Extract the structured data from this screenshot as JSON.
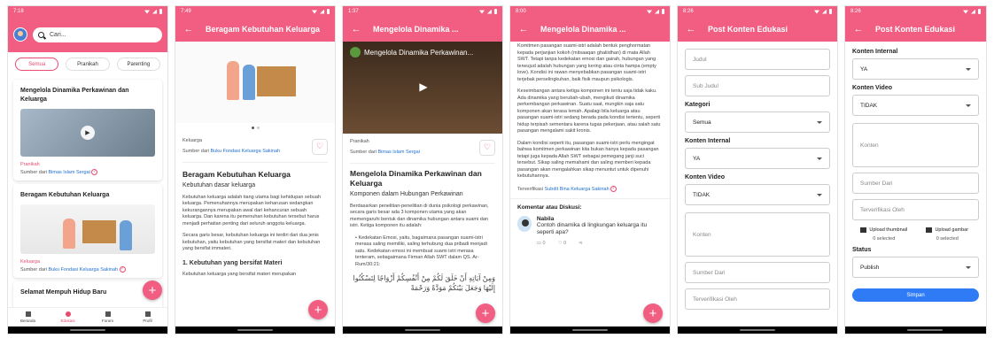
{
  "colors": {
    "primary": "#f25d82",
    "accent": "#e84a70",
    "link": "#1f6fcf",
    "save": "#2f7bf6"
  },
  "screens": [
    {
      "time": "7:18",
      "search_placeholder": "Cari...",
      "chips": [
        "Semua",
        "Pranikah",
        "Parenting"
      ],
      "cards": [
        {
          "title": "Mengelola Dinamika Perkawinan dan Keluarga",
          "category": "Pranikah",
          "source_prefix": "Sumber dari",
          "source": "Bimas Islam Sergai"
        },
        {
          "title": "Beragam Kebutuhan Keluarga",
          "category": "Keluarga",
          "source_prefix": "Sumber dari",
          "source": "Buku Fondasi Keluarga Sakinah"
        },
        {
          "title": "Selamat Mempuh Hidup Baru"
        }
      ],
      "nav": [
        "Beranda",
        "Edukasi",
        "Forum",
        "Profil"
      ],
      "fab": "+"
    },
    {
      "time": "7:49",
      "title": "Beragam Kebutuhan Keluarga",
      "category": "Keluarga",
      "source_prefix": "Sumber dari",
      "source": "Buku Fondasi Keluarga Sakinah",
      "heading": "Beragam Kebutuhan Keluarga",
      "subheading": "Kebutuhan dasar keluarga",
      "para1": "Kebutuhan keluarga adalah tiang utama bagi kehidupan sebuah keluarga. Pemenuhannya merupakan keharusan sedangkan kekurangannya merupakan awal dari kehancuran sebuah keluarga. Dan karena itu pemenuhan kebutuhan tersebut harus menjadi perhatian penting dari seluruh anggota keluarga.",
      "para2": "Secara garis besar, kebutuhan keluarga ini terdiri dari dua jenis kebutuhan, yaitu kebutuhan yang bersifat materi dan kebutuhan yang bersifat immateri.",
      "section": "1. Kebutuhan yang bersifat Materi",
      "para3": "Kebutuhan keluarga yang bersifat materi merupakan",
      "fab": "+"
    },
    {
      "time": "1:37",
      "title": "Mengelola Dinamika ...",
      "video_title": "Mengelola Dinamika Perkawinan...",
      "category": "Pranikah",
      "source_prefix": "Sumber dari",
      "source": "Bimas Islam Sergai",
      "heading": "Mengelola Dinamika Perkawinan dan Keluarga",
      "subheading": "Komponen dalam Hubungan Perkawinan",
      "para1": "Berdasarkan penelitian-penelitian di dunia psikologi perkawinan, secara garis besar ada 3 komponen utama yang akan memengaruhi bentuk dan dinamika hubungan antara suami dan istri. Ketiga komponen itu adalah:",
      "bullet": "Kedekatan Emosi, yaitu, bagaimana pasangan suami-istri merasa saling memiliki, saling terhubung dua pribadi menjadi satu. Kedekatan emosi ini membuat suami istri merasa tenteram, sebagaimana Firman Allah SWT dalam QS. Ar-Rum/30:21:",
      "arabic": "وَمِنْ آيَاتِهِ أَنْ خَلَقَ لَكُمْ مِنْ أَنْفُسِكُمْ أَزْوَاجًا لِتَسْكُنُوا إِلَيْهَا وَجَعَلَ بَيْنَكُمْ مَوَدَّةً وَرَحْمَةً",
      "fab": "+"
    },
    {
      "time": "8:00",
      "title": "Mengelola Dinamika ...",
      "para1": "Komitmen pasangan suami-istri adalah bentuk penghormatan kepada perjanjian kokoh (mitsaaqan ghaliidhan) di mata Allah SWT. Tetapi tanpa kedekatan emosi dan gairah, hubungan yang terwujud adalah hubungan yang kering atau cinta hampa (empty love). Kondisi ini rawan menyebabkan pasangan suami-istri terjebak perselingkuhan, baik fisik maupun psikologis.",
      "para2": "Keseimbangan antara ketiga komponen ini tentu saja tidak kaku. Ada dinamika yang berubah-ubah, mengikuti dinamika perkembangan perkawinan. Suatu saat, mungkin saja satu komponen akan terasa lemah. Apalagi bila keluarga atau pasangan suami-istri sedang berada pada kondisi tertentu, seperti hidup terpisah sementara karena tugas pekerjaan, atau salah satu pasangan mengalami sakit kronis.",
      "para3": "Dalam kondisi seperti itu, pasangan suami-istri perlu mengingat bahwa komitmen perkawinan kita bukan hanya kepada pasangan tetapi juga kepada Allah SWT sebagai pemegang janji suci tersebut. Sikap saling memahami dan saling memberi kepada pasangan akan mengalahkan sikap menuntut untuk dipenuhi kebutuhannya.",
      "verified_prefix": "Terverifikasi",
      "verified": "Subdit Bina Keluarga Sakinah",
      "comment_header": "Komentar atau Diskusi:",
      "comment_name": "Nabila",
      "comment_text": "Contoh dinamika di lingkungan keluarga itu seperti apa?",
      "comment_replies": "0",
      "comment_likes": "0",
      "fab": "+"
    },
    {
      "time": "8:26",
      "title": "Post Konten Edukasi",
      "judul": "Judul",
      "sub_judul": "Sub Judul",
      "kategori_label": "Kategori",
      "kategori_value": "Semua",
      "internal_label": "Konten Internal",
      "internal_value": "YA",
      "video_label": "Konten Video",
      "video_value": "TIDAK",
      "konten": "Konten",
      "sumber": "Sumber Dari",
      "verif": "Terverifikasi Oleh"
    },
    {
      "time": "8:26",
      "title": "Post Konten Edukasi",
      "internal_label": "Konten Internal",
      "internal_value": "YA",
      "video_label": "Konten Video",
      "video_value": "TIDAK",
      "konten": "Konten",
      "sumber": "Sumber Dari",
      "verif": "Terverifikasi Oleh",
      "upload_thumb": "Upload thumbnail",
      "upload_gambar": "Upload gambar",
      "thumb_selected": "0 selected",
      "gambar_selected": "0 selected",
      "status_label": "Status",
      "status_value": "Publish",
      "save": "Simpan"
    }
  ]
}
